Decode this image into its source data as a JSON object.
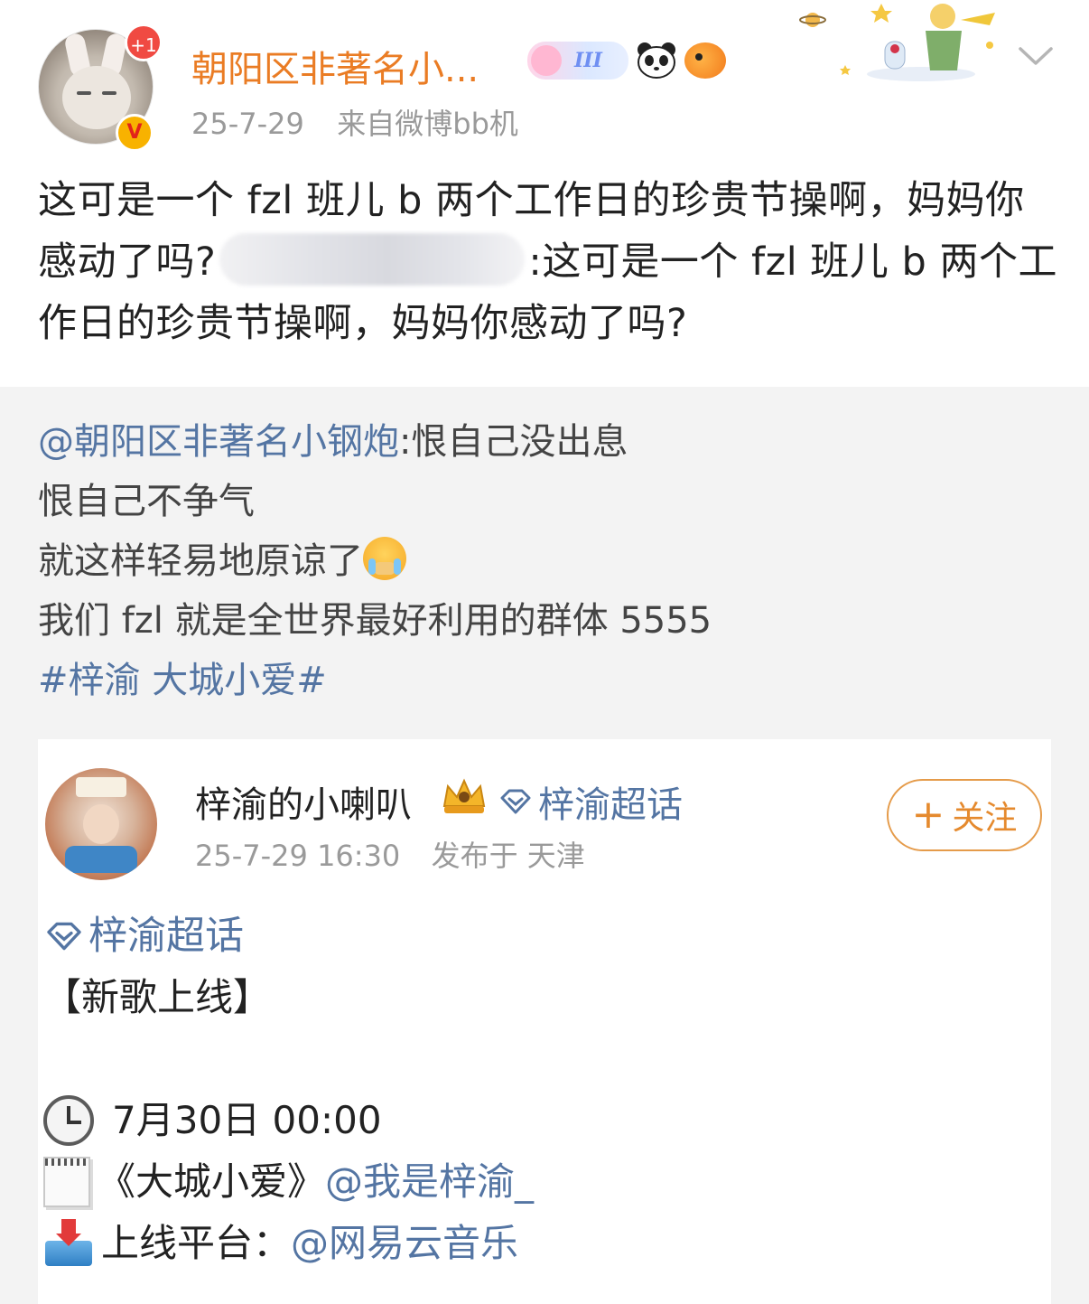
{
  "post": {
    "author_name": "朝阳区非著名小...",
    "notification_count": "+1",
    "verified_mark": "V",
    "level_badge": "III",
    "date": "25-7-29",
    "source_prefix": "来自",
    "source_app": "微博bb机",
    "text_part1": "这可是一个 fzl 班儿 b 两个工作日的珍贵节操啊，妈妈你感动了吗?",
    "text_part2": ":这可是一个 fzl 班儿 b 两个工作日的珍贵节操啊，妈妈你感动了吗?"
  },
  "repost": {
    "mention": "@朝阳区非著名小钢炮",
    "line1_rest": ":恨自己没出息",
    "line2": "恨自己不争气",
    "line3": "就这样轻易地原谅了",
    "line4": "我们 fzl 就是全世界最好利用的群体 5555",
    "topic": "#梓渝 大城小爱#"
  },
  "card": {
    "author_name": "梓渝的小喇叭",
    "super_topic": "梓渝超话",
    "datetime": "25-7-29 16:30",
    "location": "发布于 天津",
    "follow_label": "关注",
    "follow_plus": "+",
    "body_topic": "梓渝超话",
    "headline": "【新歌上线】",
    "release_time": "7月30日 00:00",
    "song_title": "《大城小爱》",
    "artist_mention": "@我是梓渝_",
    "platform_label": "上线平台：",
    "platform_mention": "@网易云音乐"
  },
  "icons": {
    "chevron": "chevron-down-icon",
    "clock": "clock-icon",
    "notepad": "notepad-icon",
    "inbox": "inbox-tray-icon",
    "diamond": "diamond-icon",
    "crown": "crown-icon",
    "panda": "panda-icon",
    "fish": "pufferfish-icon"
  },
  "colors": {
    "username": "#ea7c24",
    "link": "#5475a3",
    "meta": "#9a9a9a",
    "repost_bg": "#f3f3f3",
    "follow": "#e58a2e",
    "badge_red": "#f04a42"
  }
}
